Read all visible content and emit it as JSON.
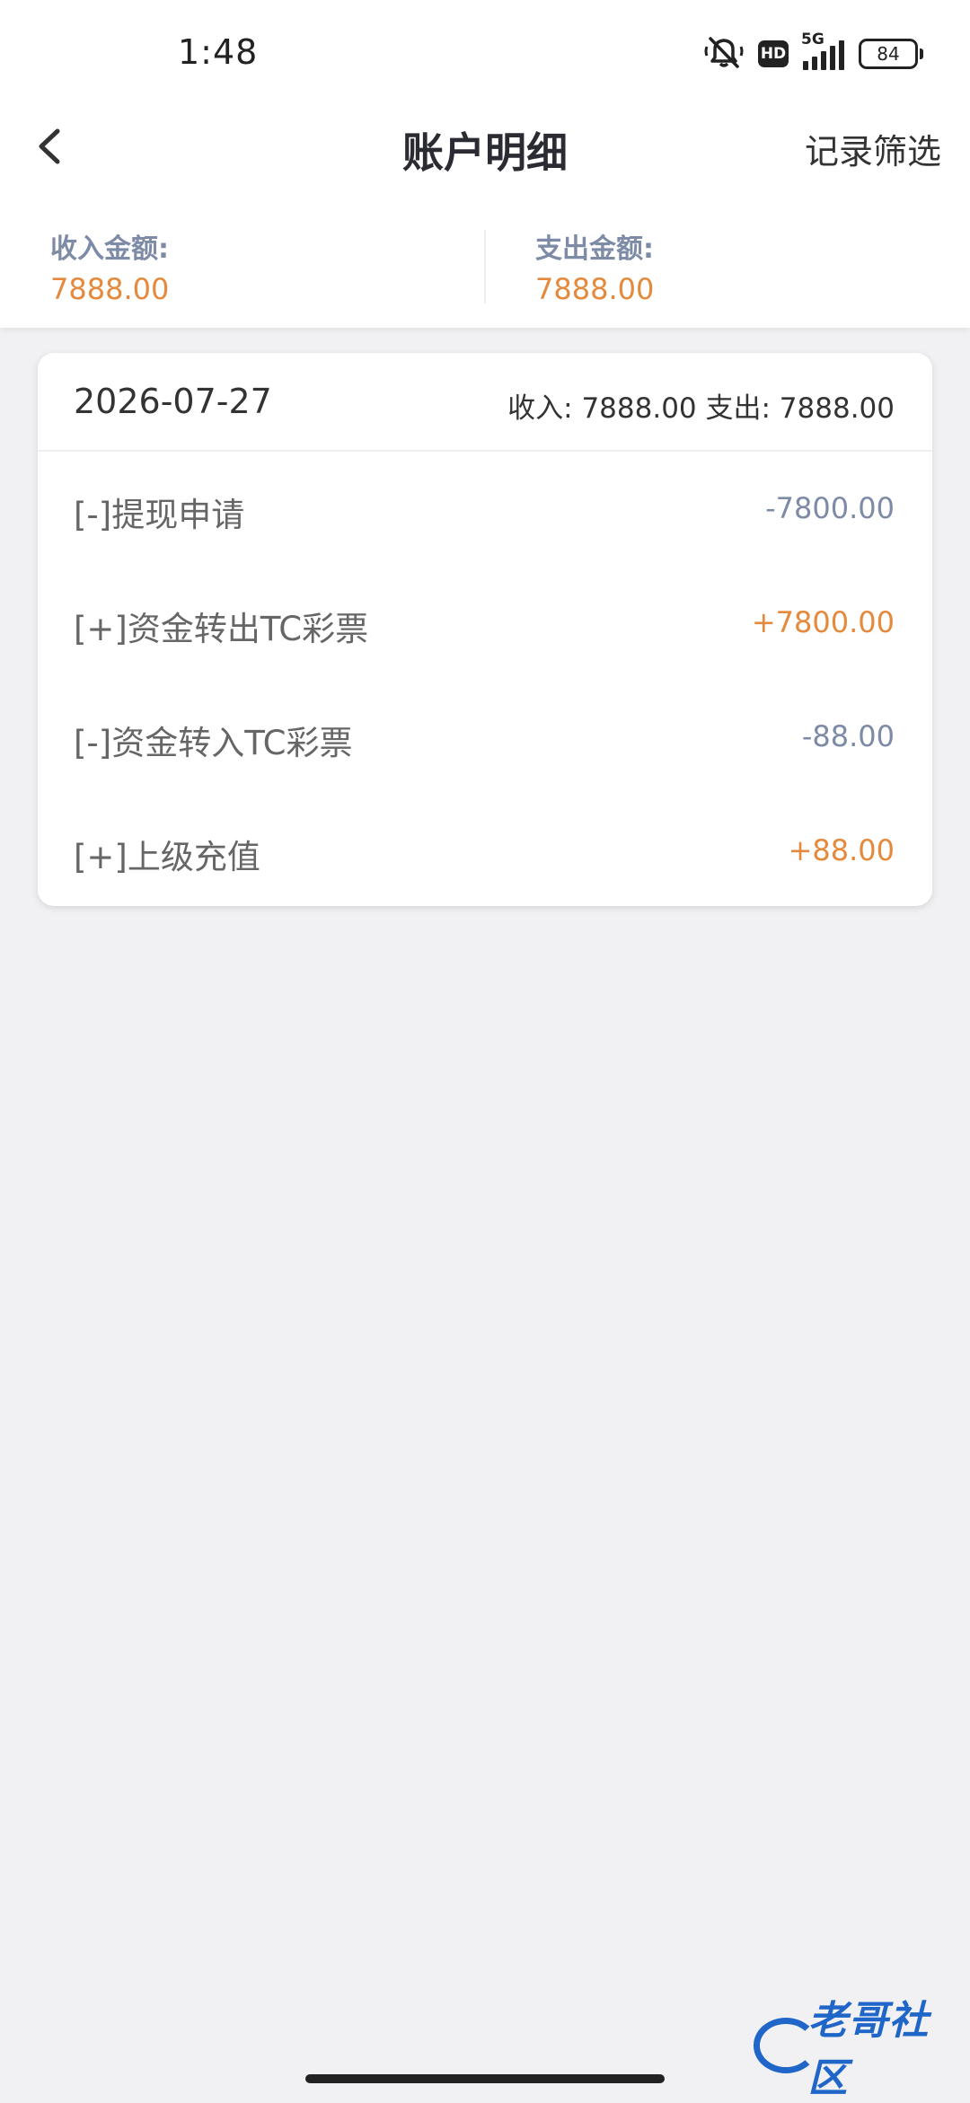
{
  "status_bar": {
    "time": "1:48",
    "hd": "HD",
    "network": "5G",
    "battery": "84"
  },
  "header": {
    "title": "账户明细",
    "filter_label": "记录筛选"
  },
  "summary": {
    "income_label": "收入金额:",
    "income_value": "7888.00",
    "expense_label": "支出金额:",
    "expense_value": "7888.00"
  },
  "day_group": {
    "date": "2026-07-27",
    "totals": "收入: 7888.00 支出: 7888.00",
    "transactions": [
      {
        "label": "[-]提现申请",
        "amount": "-7800.00"
      },
      {
        "label": "[+]资金转出TC彩票",
        "amount": "+7800.00"
      },
      {
        "label": "[-]资金转入TC彩票",
        "amount": "-88.00"
      },
      {
        "label": "[+]上级充值",
        "amount": "+88.00"
      }
    ]
  },
  "watermark": {
    "text": "老哥社区"
  },
  "colors": {
    "accent_orange": "#e58a3c",
    "muted_blue_gray": "#7e8ba6",
    "watermark_blue": "#1f66c8"
  }
}
